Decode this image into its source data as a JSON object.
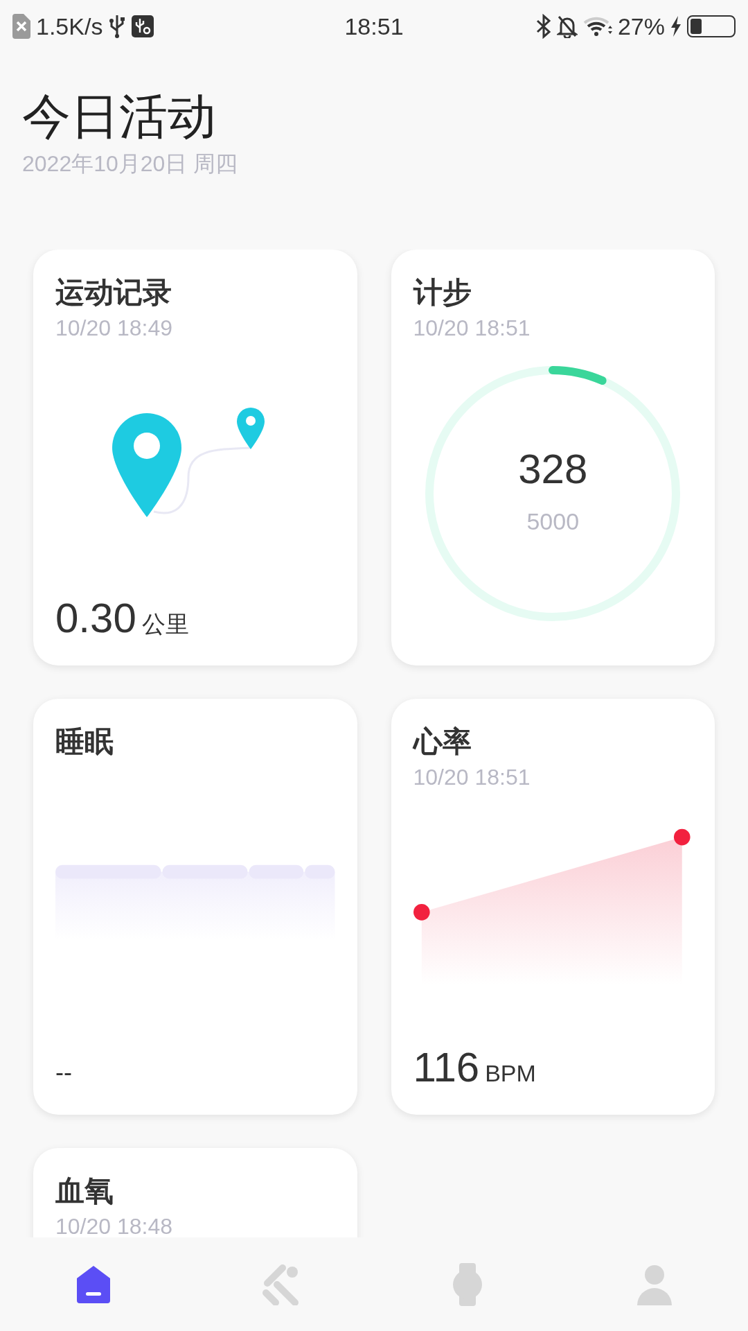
{
  "status_bar": {
    "net_speed": "1.5K/s",
    "time": "18:51",
    "battery": "27%"
  },
  "header": {
    "title": "今日活动",
    "date": "2022年10月20日 周四"
  },
  "cards": [
    {
      "kind": "route",
      "title": "运动记录",
      "time": "10/20 18:49",
      "value": "0.30",
      "unit": "公里"
    },
    {
      "kind": "steps",
      "title": "计步",
      "time": "10/20 18:51",
      "value": "328",
      "goal": "5000"
    },
    {
      "kind": "sleep",
      "title": "睡眠",
      "value": "--"
    },
    {
      "kind": "heart",
      "title": "心率",
      "time": "10/20 18:51",
      "value": "116",
      "unit": "BPM"
    },
    {
      "kind": "oxygen",
      "title": "血氧",
      "time": "10/20 18:48"
    }
  ],
  "nav": [
    {
      "kind": "home",
      "selected": true
    },
    {
      "kind": "workout",
      "selected": false
    },
    {
      "kind": "watch",
      "selected": false
    },
    {
      "kind": "profile",
      "selected": false
    }
  ]
}
